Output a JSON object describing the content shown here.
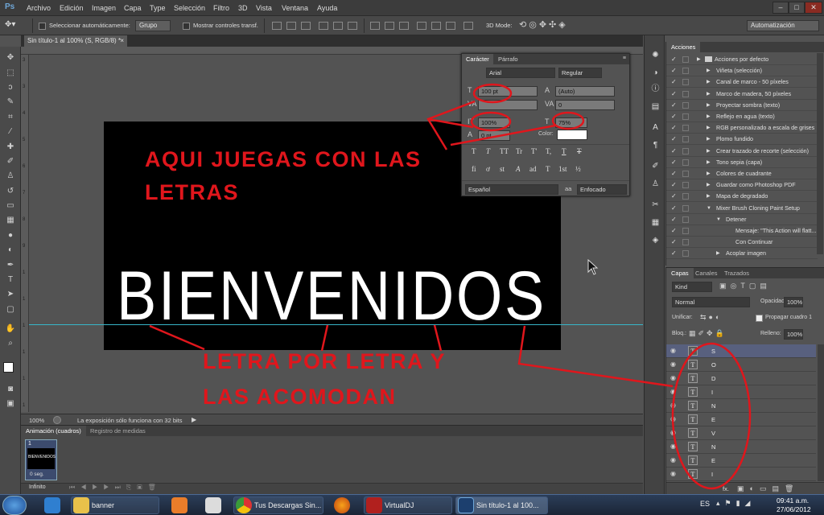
{
  "app": {
    "logo": "Ps"
  },
  "menu": [
    "Archivo",
    "Edición",
    "Imagen",
    "Capa",
    "Type",
    "Selección",
    "Filtro",
    "3D",
    "Vista",
    "Ventana",
    "Ayuda"
  ],
  "window_controls": [
    "–",
    "□",
    "✕"
  ],
  "options_bar": {
    "auto_select_label": "Seleccionar automáticamente:",
    "auto_select_value": "Grupo",
    "show_transform_label": "Mostrar controles transf.",
    "mode_label": "3D Mode:",
    "workspace": "Automatización"
  },
  "document_tab": {
    "title": "Sin título-1 al 100% (S, RGB/8) *",
    "close": "×"
  },
  "rulers": {
    "left_marks": [
      "3",
      "3",
      "4",
      "5",
      "6",
      "7",
      "8",
      "9",
      "1",
      "1",
      "1",
      "1",
      "1",
      "1"
    ]
  },
  "canvas": {
    "main_text": "BIENVENIDOS",
    "annotation_top": [
      "AQUI JUEGAS CON LAS",
      "LETRAS"
    ],
    "annotation_bottom": [
      "LETRA POR LETRA Y",
      "LAS ACOMODAN"
    ]
  },
  "status_bar": {
    "zoom": "100%",
    "message": "La exposición sólo funciona con 32 bits"
  },
  "animation_panel": {
    "tabs": [
      "Animación (cuadros)",
      "Registro de medidas"
    ],
    "frame_number": "1",
    "frame_thumb_text": "BIENVENIDOS",
    "frame_delay": "0 seg.",
    "loop": "Infinito"
  },
  "character_panel": {
    "tabs": [
      "Carácter",
      "Párrafo"
    ],
    "font_family": "Arial",
    "font_style": "Regular",
    "font_size": "100 pt",
    "leading": "(Auto)",
    "kerning": "",
    "tracking": "0",
    "vertical_scale": "100%",
    "horizontal_scale": "75%",
    "baseline_shift": "0 pt",
    "color_label": "Color:",
    "style_glyphs": [
      "T",
      "T",
      "TT",
      "Tr",
      "T'",
      "T,",
      "T",
      "T"
    ],
    "opentype_glyphs": [
      "fi",
      "ơ",
      "st",
      "A",
      "ad",
      "T",
      "1st",
      "½"
    ],
    "language": "Español",
    "antialias_icon": "aa",
    "antialias": "Enfocado"
  },
  "actions_panel": {
    "title": "Acciones",
    "items": [
      {
        "label": "Acciones por defecto",
        "level": 0,
        "folder": true
      },
      {
        "label": "Viñeta (selección)",
        "level": 1
      },
      {
        "label": "Canal de marco - 50 píxeles",
        "level": 1
      },
      {
        "label": "Marco de madera, 50 píxeles",
        "level": 1
      },
      {
        "label": "Proyectar sombra (texto)",
        "level": 1
      },
      {
        "label": "Reflejo en agua (texto)",
        "level": 1
      },
      {
        "label": "RGB personalizado a escala de grises",
        "level": 1
      },
      {
        "label": "Plomo fundido",
        "level": 1
      },
      {
        "label": "Crear trazado de recorte (selección)",
        "level": 1
      },
      {
        "label": "Tono sepia (capa)",
        "level": 1
      },
      {
        "label": "Colores de cuadrante",
        "level": 1
      },
      {
        "label": "Guardar como Photoshop PDF",
        "level": 1
      },
      {
        "label": "Mapa de degradado",
        "level": 1
      },
      {
        "label": "Mixer Brush Cloning Paint Setup",
        "level": 1,
        "expanded": true
      },
      {
        "label": "Detener",
        "level": 2,
        "expanded": true
      },
      {
        "label": "Mensaje: \"This Action will flatt...",
        "level": 3
      },
      {
        "label": "Con Continuar",
        "level": 3
      },
      {
        "label": "Acoplar imagen",
        "level": 2
      }
    ]
  },
  "layers_panel": {
    "tabs": [
      "Capas",
      "Canales",
      "Trazados"
    ],
    "filter_kind": "Kind",
    "blend_mode": "Normal",
    "opacity_label": "Opacidad:",
    "opacity": "100%",
    "unify_label": "Unificar:",
    "propagate_label": "Propagar cuadro 1",
    "lock_label": "Bloq.:",
    "fill_label": "Relleno:",
    "fill": "100%",
    "layers": [
      "S",
      "O",
      "D",
      "I",
      "N",
      "E",
      "V",
      "N",
      "E",
      "I"
    ],
    "selected_index": 0,
    "fx_label": "fx."
  },
  "taskbar": {
    "items": [
      "banner",
      "Tus Descargas Sin...",
      "VirtualDJ",
      "Sin título-1 al 100..."
    ],
    "language": "ES",
    "time": "09:41 a.m.",
    "date": "27/06/2012"
  },
  "colors": {
    "annotation": "#e0161c",
    "guide": "#37b5c8",
    "selected_layer": "#58607e",
    "taskbar": "#1f2c42"
  }
}
